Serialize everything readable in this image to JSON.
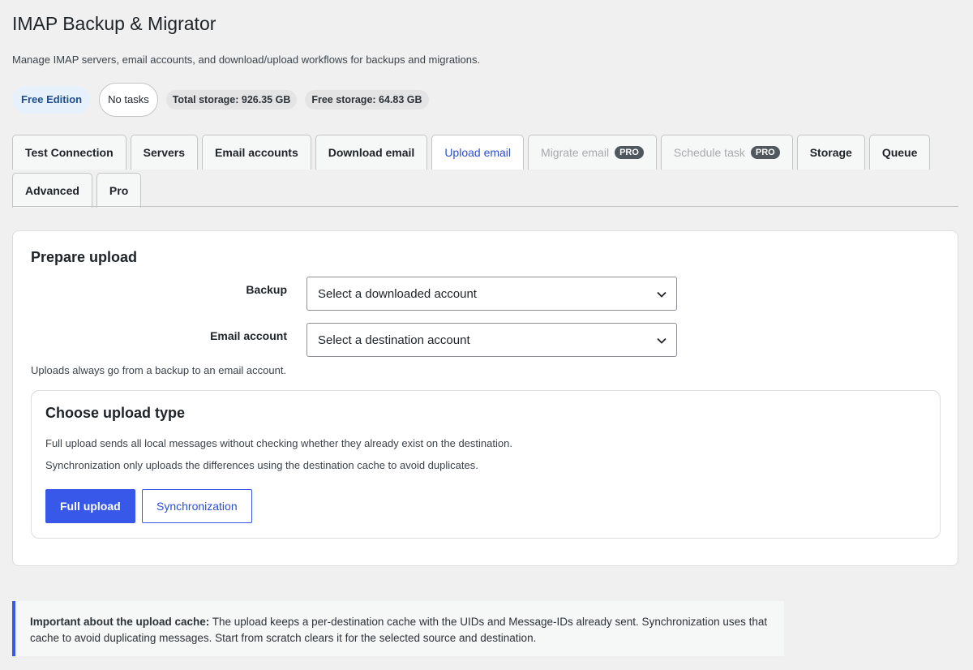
{
  "page": {
    "title": "IMAP Backup & Migrator",
    "description": "Manage IMAP servers, email accounts, and download/upload workflows for backups and migrations."
  },
  "badges": {
    "edition": "Free Edition",
    "tasks": "No tasks",
    "total_storage": "Total storage: 926.35 GB",
    "free_storage": "Free storage: 64.83 GB"
  },
  "tabs": {
    "row1": [
      {
        "label": "Test Connection",
        "state": "normal"
      },
      {
        "label": "Servers",
        "state": "normal"
      },
      {
        "label": "Email accounts",
        "state": "normal"
      },
      {
        "label": "Download email",
        "state": "normal"
      },
      {
        "label": "Upload email",
        "state": "active"
      },
      {
        "label": "Migrate email",
        "state": "disabled",
        "pro": "PRO"
      },
      {
        "label": "Schedule task",
        "state": "disabled",
        "pro": "PRO"
      },
      {
        "label": "Storage",
        "state": "normal"
      },
      {
        "label": "Queue",
        "state": "normal"
      }
    ],
    "row2": [
      {
        "label": "Advanced",
        "state": "normal"
      },
      {
        "label": "Pro",
        "state": "normal"
      }
    ]
  },
  "prepare": {
    "title": "Prepare upload",
    "backup_label": "Backup",
    "backup_value": "Select a downloaded account",
    "email_label": "Email account",
    "email_value": "Select a destination account",
    "hint": "Uploads always go from a backup to an email account."
  },
  "upload_type": {
    "title": "Choose upload type",
    "line1": "Full upload sends all local messages without checking whether they already exist on the destination.",
    "line2": "Synchronization only uploads the differences using the destination cache to avoid duplicates.",
    "full_button": "Full upload",
    "sync_button": "Synchronization"
  },
  "notice": {
    "title": "Important about the upload cache:",
    "body": " The upload keeps a per-destination cache with the UIDs and Message-IDs already sent. Synchronization uses that cache to avoid duplicating messages. Start from scratch clears it for the selected source and destination."
  },
  "colors": {
    "accent": "#3858e9",
    "active_tab_text": "#2c4fd1",
    "background": "#f0f0f1"
  }
}
